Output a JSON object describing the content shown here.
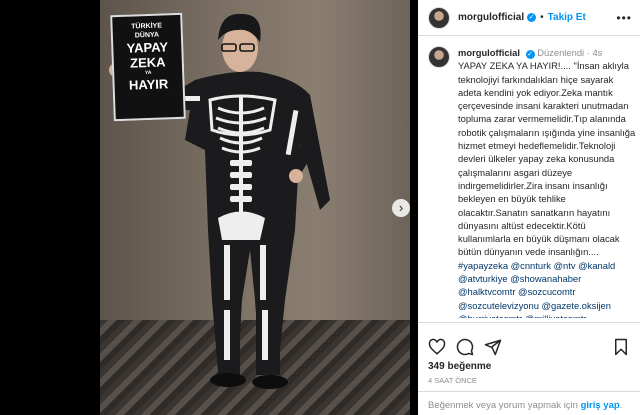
{
  "post": {
    "username": "morgulofficial",
    "follow_label": "Takip Et",
    "edited_label": "Düzenlendi",
    "caption_time": "4s",
    "caption_text": "YAPAY ZEKA YA HAYIR!.... \"İnsan aklıyla teknolojiyi farkındalıkları hiçe sayarak adeta kendini yok ediyor.Zeka mantık çerçevesinde insani karakteri unutmadan topluma zarar vermemelidir.Tıp alanında robotik çalışmaların ışığında yine insanlığa hizmet etmeyi hedeflemelidir.Teknoloji devleri ülkeler yapay zeka konusunda çalışmalarını asgari düzeye indirgemelidirler.Zira insanı insanlığı bekleyen en büyük tehlike olacaktır.Sanatın sanatkarın hayatını dünyasını altüst edecektir.Kötü kullanımlarla en büyük düşmanı olacak bütün dünyanın vede insanlığın....",
    "mentions": "#yapayzeka @cnnturk @ntv @kanald @atvturkiye @showanahaber @halktvcomtr @sozcucomtr @sozcutelevizyonu @gazete.oksijen @hurriyetcomtr @milliyetcomtr @sabah.gunaydin @aksam @ekoltvv",
    "likes": "349 beğenme",
    "time_ago": "4 saat önce",
    "login_prompt": "Beğenmek veya yorum yapmak için",
    "login_link": "giriş yap",
    "login_suffix": "."
  },
  "media": {
    "sign_lines": [
      "TÜRKİYE",
      "DÜNYA",
      "YAPAY",
      "ZEKA",
      "YA",
      "HAYIR"
    ]
  },
  "icons": {
    "like": "heart-icon",
    "comment": "comment-icon",
    "share": "share-icon",
    "save": "bookmark-icon",
    "next": "chevron-right-icon",
    "more": "more-icon",
    "verified": "verified-badge-icon"
  }
}
